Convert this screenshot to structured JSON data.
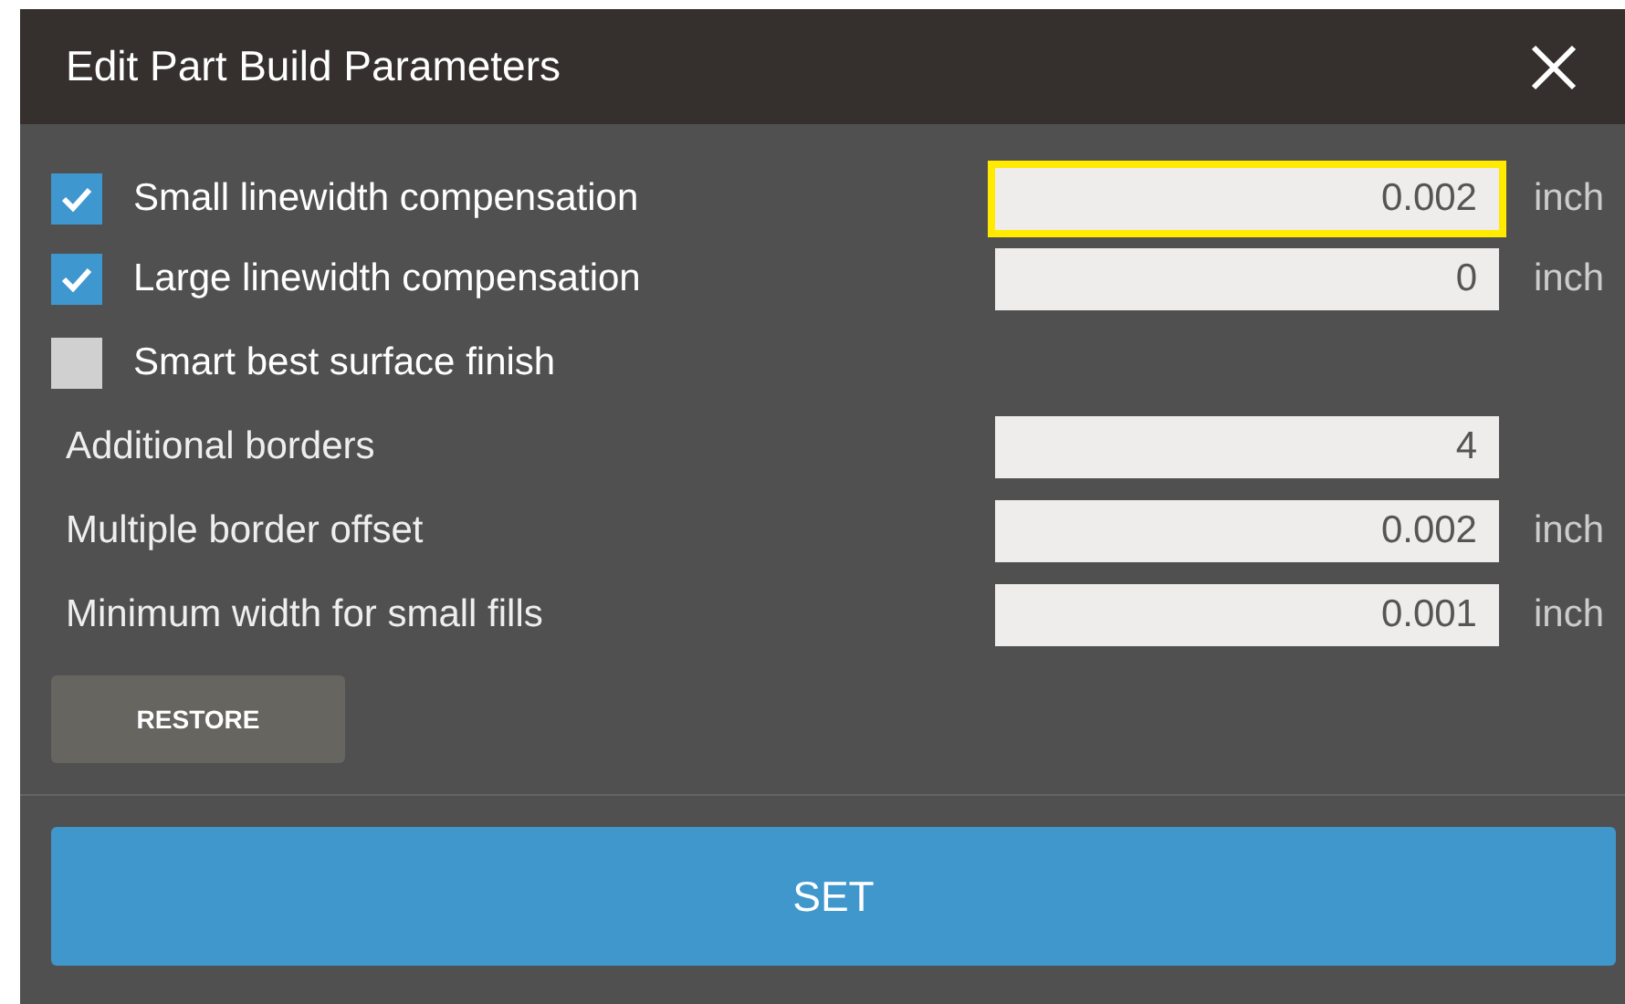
{
  "window": {
    "title": "Edit Part Build Parameters"
  },
  "rows": [
    {
      "kind": "checkbox",
      "label": "Small linewidth compensation",
      "checked": true,
      "value": "0.002",
      "focused": true,
      "unit": "inch"
    },
    {
      "kind": "checkbox",
      "label": "Large linewidth compensation",
      "checked": true,
      "value": "0",
      "focused": false,
      "unit": "inch"
    },
    {
      "kind": "checkbox",
      "label": "Smart best surface finish",
      "checked": false
    },
    {
      "kind": "plain",
      "label": "Additional borders",
      "value": "4",
      "focused": false
    },
    {
      "kind": "plain",
      "label": "Multiple border offset",
      "value": "0.002",
      "focused": false,
      "unit": "inch"
    },
    {
      "kind": "plain",
      "label": "Minimum width for small fills",
      "value": "0.001",
      "focused": false,
      "unit": "inch"
    }
  ],
  "buttons": {
    "restore": "RESTORE",
    "set": "SET"
  }
}
